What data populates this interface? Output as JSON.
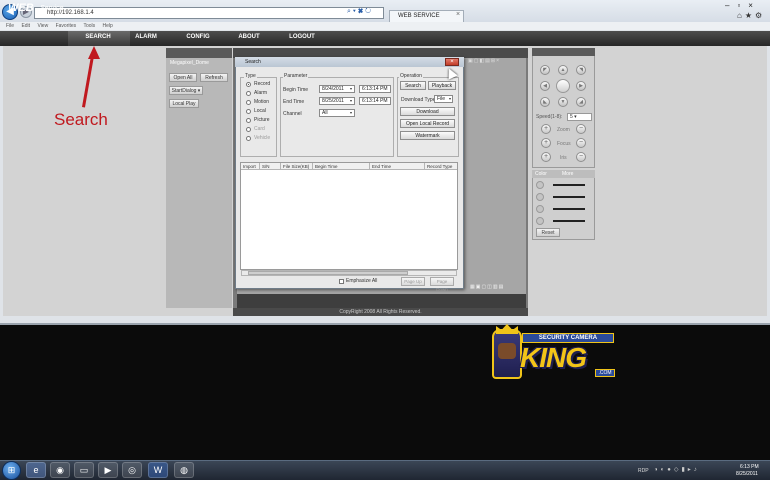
{
  "browser": {
    "address": "http://192.168.1.4",
    "tab_title": "WEB SERVICE",
    "menu": "File  Edit  View  Favorites  Tools  Help"
  },
  "nav": {
    "logo_main": "WEB",
    "logo_sub": "Service",
    "items": [
      "SEARCH",
      "ALARM",
      "CONFIG",
      "ABOUT",
      "LOGOUT"
    ]
  },
  "left_panel": {
    "device_name": "Megapixel_Dome",
    "open_all": "Open All",
    "refresh": "Refresh",
    "start_dialog": "StartDialog",
    "local_play": "Local Play"
  },
  "ptz": {
    "speed_label": "Speed(1-8):",
    "speed_value": "5",
    "zoom": "Zoom",
    "focus": "Focus",
    "iris": "Iris"
  },
  "color_panel": {
    "tab_color": "Color",
    "tab_more": "More",
    "reset": "Reset"
  },
  "footer": "CopyRight 2008 All Rights Reserved.",
  "dialog": {
    "title": "Search",
    "type_label": "Type",
    "types": [
      {
        "label": "Record",
        "selected": true,
        "disabled": false
      },
      {
        "label": "Alarm",
        "selected": false,
        "disabled": false
      },
      {
        "label": "Motion",
        "selected": false,
        "disabled": false
      },
      {
        "label": "Local",
        "selected": false,
        "disabled": false
      },
      {
        "label": "Picture",
        "selected": false,
        "disabled": false
      },
      {
        "label": "Card",
        "selected": false,
        "disabled": true
      },
      {
        "label": "Vehicle",
        "selected": false,
        "disabled": true
      }
    ],
    "parameter_label": "Parameter",
    "begin_time_label": "Begin Time",
    "begin_date": "8/24/2011",
    "begin_time": "6:13:14 PM",
    "end_time_label": "End Time",
    "end_date": "8/25/2011",
    "end_time": "6:13:14 PM",
    "channel_label": "Channel",
    "channel_value": "All",
    "operation_label": "Operation",
    "search_btn": "Search",
    "playback_btn": "Playback",
    "download_type_label": "Download Type",
    "download_type_value": "File",
    "download_btn": "Download",
    "open_local_record_btn": "Open Local Record",
    "watermark_btn": "Watermark",
    "columns": [
      "Import",
      "S/N",
      "File Size(KB)",
      "Begin Time",
      "End Time",
      "Record Type"
    ],
    "emphasize_label": "Emphasize All",
    "page_up": "Page Up",
    "page_down": "Page Down"
  },
  "annotation": {
    "text": "Search",
    "color": "#c0191f"
  },
  "brand": {
    "top": "SECURITY CAMERA",
    "main": "KING",
    "suffix": ".COM"
  },
  "taskbar": {
    "tray_label": "RDP",
    "time": "6:13 PM",
    "date": "8/25/2011"
  }
}
